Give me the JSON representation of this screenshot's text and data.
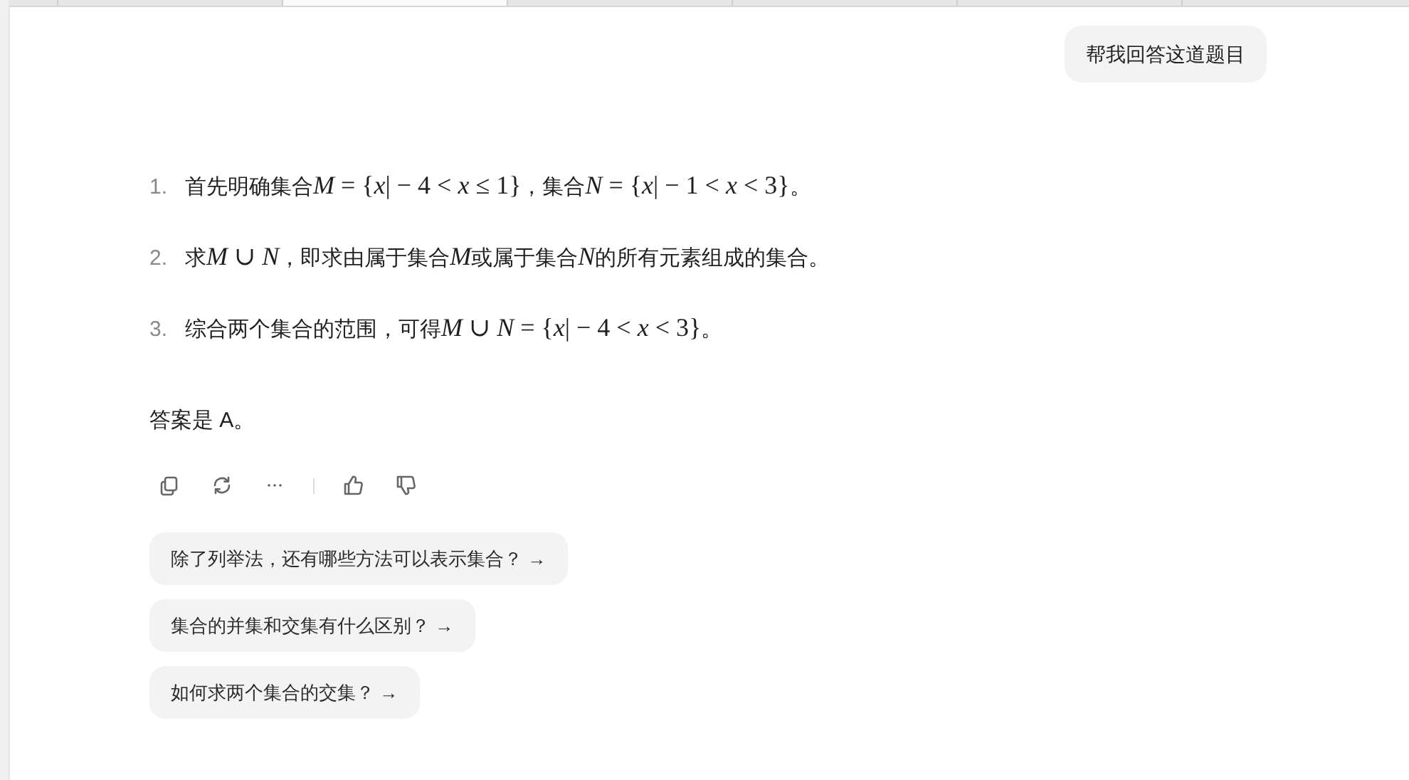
{
  "user_message": "帮我回答这道题目",
  "steps": [
    {
      "number": "1.",
      "parts": [
        {
          "kind": "text",
          "text": "首先明确集合"
        },
        {
          "kind": "math",
          "text": "*M* = {*x*| − 4 < *x* ≤ 1}"
        },
        {
          "kind": "text",
          "text": "，集合"
        },
        {
          "kind": "math",
          "text": "*N* = {*x*| − 1 < *x* < 3}"
        },
        {
          "kind": "text",
          "text": "。"
        }
      ]
    },
    {
      "number": "2.",
      "parts": [
        {
          "kind": "text",
          "text": "求"
        },
        {
          "kind": "math",
          "text": "*M* ∪ *N*"
        },
        {
          "kind": "text",
          "text": "，即求由属于集合"
        },
        {
          "kind": "math",
          "text": "*M*"
        },
        {
          "kind": "text",
          "text": "或属于集合"
        },
        {
          "kind": "math",
          "text": "*N*"
        },
        {
          "kind": "text",
          "text": "的所有元素组成的集合。"
        }
      ]
    },
    {
      "number": "3.",
      "parts": [
        {
          "kind": "text",
          "text": "综合两个集合的范围，可得"
        },
        {
          "kind": "math",
          "text": "*M* ∪ *N* = {*x*| − 4 < *x* < 3}"
        },
        {
          "kind": "text",
          "text": "。"
        }
      ]
    }
  ],
  "answer": "答案是 A。",
  "actions": [
    {
      "kind": "copy"
    },
    {
      "kind": "regenerate"
    },
    {
      "kind": "more"
    },
    {
      "kind": "divider"
    },
    {
      "kind": "like"
    },
    {
      "kind": "dislike"
    }
  ],
  "suggestions": [
    {
      "label": "除了列举法，还有哪些方法可以表示集合？",
      "arrow": "→"
    },
    {
      "label": "集合的并集和交集有什么区别？",
      "arrow": "→"
    },
    {
      "label": "如何求两个集合的交集？",
      "arrow": "→"
    }
  ]
}
